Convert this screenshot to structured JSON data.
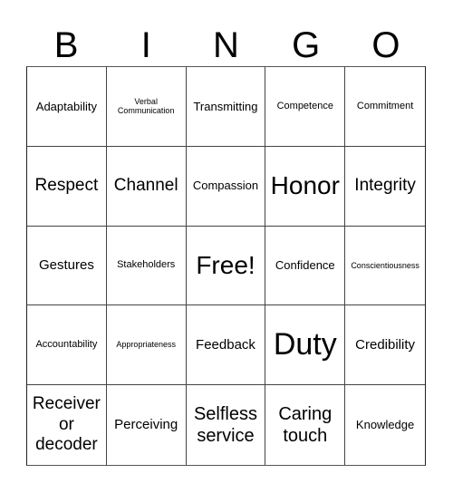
{
  "header": {
    "letters": [
      "B",
      "I",
      "N",
      "G",
      "O"
    ]
  },
  "card": {
    "rows": [
      [
        "Adaptability",
        "Verbal Communication",
        "Transmitting",
        "Competence",
        "Commitment"
      ],
      [
        "Respect",
        "Channel",
        "Compassion",
        "Honor",
        "Integrity"
      ],
      [
        "Gestures",
        "Stakeholders",
        "Free!",
        "Confidence",
        "Conscientiousness"
      ],
      [
        "Accountability",
        "Appropriateness",
        "Feedback",
        "Duty",
        "Credibility"
      ],
      [
        "Receiver or decoder",
        "Perceiving",
        "Selfless service",
        "Caring touch",
        "Knowledge"
      ]
    ],
    "free_space": "Free!"
  },
  "colors": {
    "background": "#ffffff",
    "text": "#000000",
    "grid_line": "#444444"
  }
}
